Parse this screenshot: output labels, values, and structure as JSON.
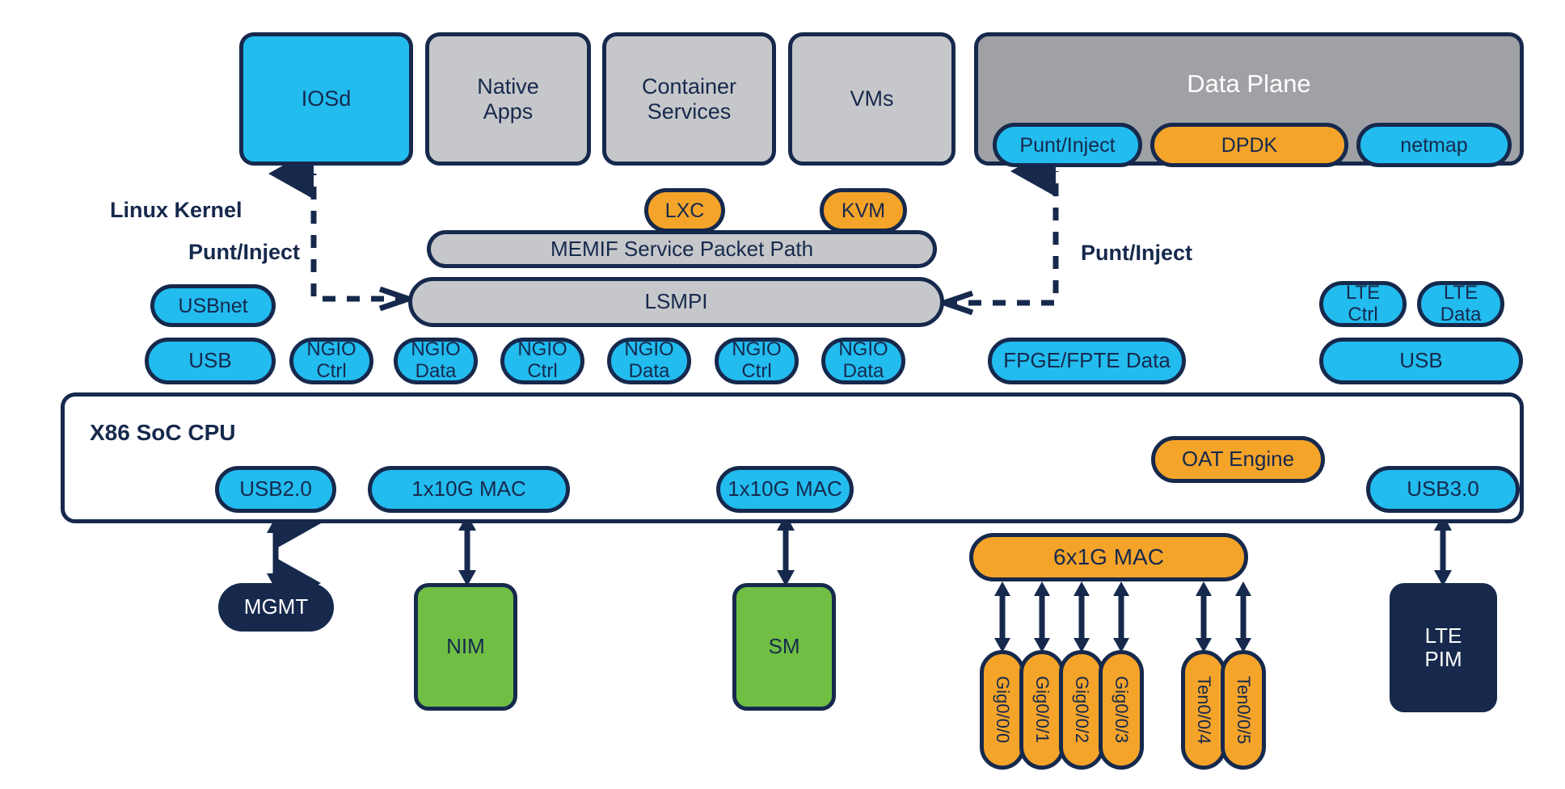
{
  "diagram": {
    "title": "Cisco Platform Software Architecture Block Diagram",
    "colors": {
      "cyan": "#22bcef",
      "orange": "#f5a42a",
      "gray_light": "#c6c7ca",
      "gray_dark": "#9fa1a5",
      "green": "#70bf44",
      "navy": "#16294d",
      "background": "#ffffff"
    }
  },
  "top_row": {
    "iosd": "IOSd",
    "native_apps": "Native\nApps",
    "container_services": "Container\nServices",
    "vms": "VMs",
    "data_plane": "Data Plane",
    "punt_inject": "Punt/Inject",
    "dpdk": "DPDK",
    "netmap": "netmap"
  },
  "kernel": {
    "linux_kernel_label": "Linux Kernel",
    "punt_inject_left_label": "Punt/Inject",
    "punt_inject_right_label": "Punt/Inject",
    "lxc": "LXC",
    "kvm": "KVM",
    "memif": "MEMIF Service Packet Path",
    "lsmpi": "LSMPI",
    "usbnet": "USBnet"
  },
  "driver_row": {
    "usb_left": "USB",
    "ngio": [
      "NGIO\nCtrl",
      "NGIO\nData",
      "NGIO\nCtrl",
      "NGIO\nData",
      "NGIO\nCtrl",
      "NGIO\nData"
    ],
    "fpge_fpte": "FPGE/FPTE Data",
    "lte_ctrl": "LTE\nCtrl",
    "lte_data": "LTE\nData",
    "usb_right": "USB"
  },
  "soc": {
    "title": "X86 SoC CPU",
    "usb20": "USB2.0",
    "mac_10g_left": "1x10G MAC",
    "mac_10g_right": "1x10G MAC",
    "oat_engine": "OAT Engine",
    "usb30": "USB3.0"
  },
  "bottom": {
    "mgmt": "MGMT",
    "nim": "NIM",
    "sm": "SM",
    "mac_6x1g": "6x1G MAC",
    "lte_pim": "LTE\nPIM",
    "ports": [
      "Gig0/0/0",
      "Gig0/0/1",
      "Gig0/0/2",
      "Gig0/0/3",
      "Ten0/0/4",
      "Ten0/0/5"
    ]
  }
}
